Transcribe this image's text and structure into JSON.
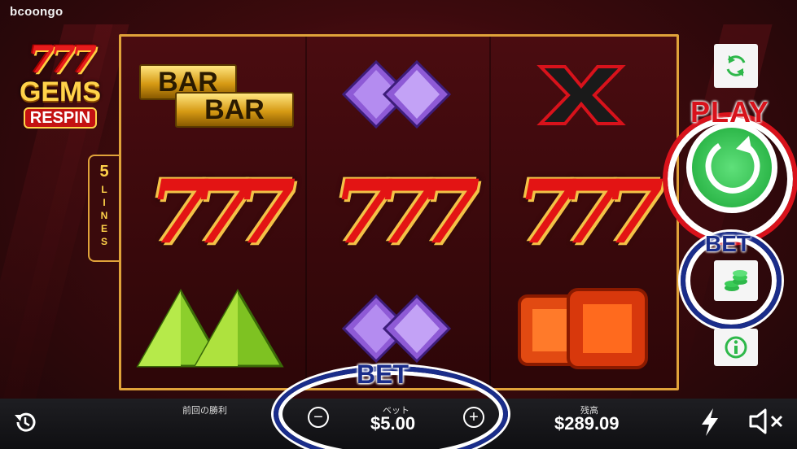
{
  "brand": "bcoongo",
  "logo": {
    "sevens": "777",
    "gems": "GEMS",
    "respin": "RESPIN"
  },
  "lines": {
    "count": "5",
    "word": "LINES"
  },
  "reels": [
    [
      "bar-double",
      "diamond-purple-double",
      "x-symbol"
    ],
    [
      "triple-seven",
      "triple-seven",
      "triple-seven"
    ],
    [
      "triangle-green-double",
      "diamond-purple-double",
      "square-red-double"
    ]
  ],
  "bar_text": "BAR",
  "seven_text": "777",
  "x_text": "X",
  "side": {
    "play_label": "PLAY",
    "bet_label": "BET"
  },
  "bottom": {
    "last_win_label": "前回の勝利",
    "bet_label": "ベット",
    "bet_value": "$5.00",
    "balance_label": "残高",
    "balance_value": "$289.09",
    "bet_ring_label": "BET",
    "minus": "−",
    "plus": "+"
  },
  "colors": {
    "play_red": "#d8121b",
    "bet_blue": "#1a2d8a",
    "frame_gold": "#e0a33a",
    "play_green": "#2eb84a"
  }
}
